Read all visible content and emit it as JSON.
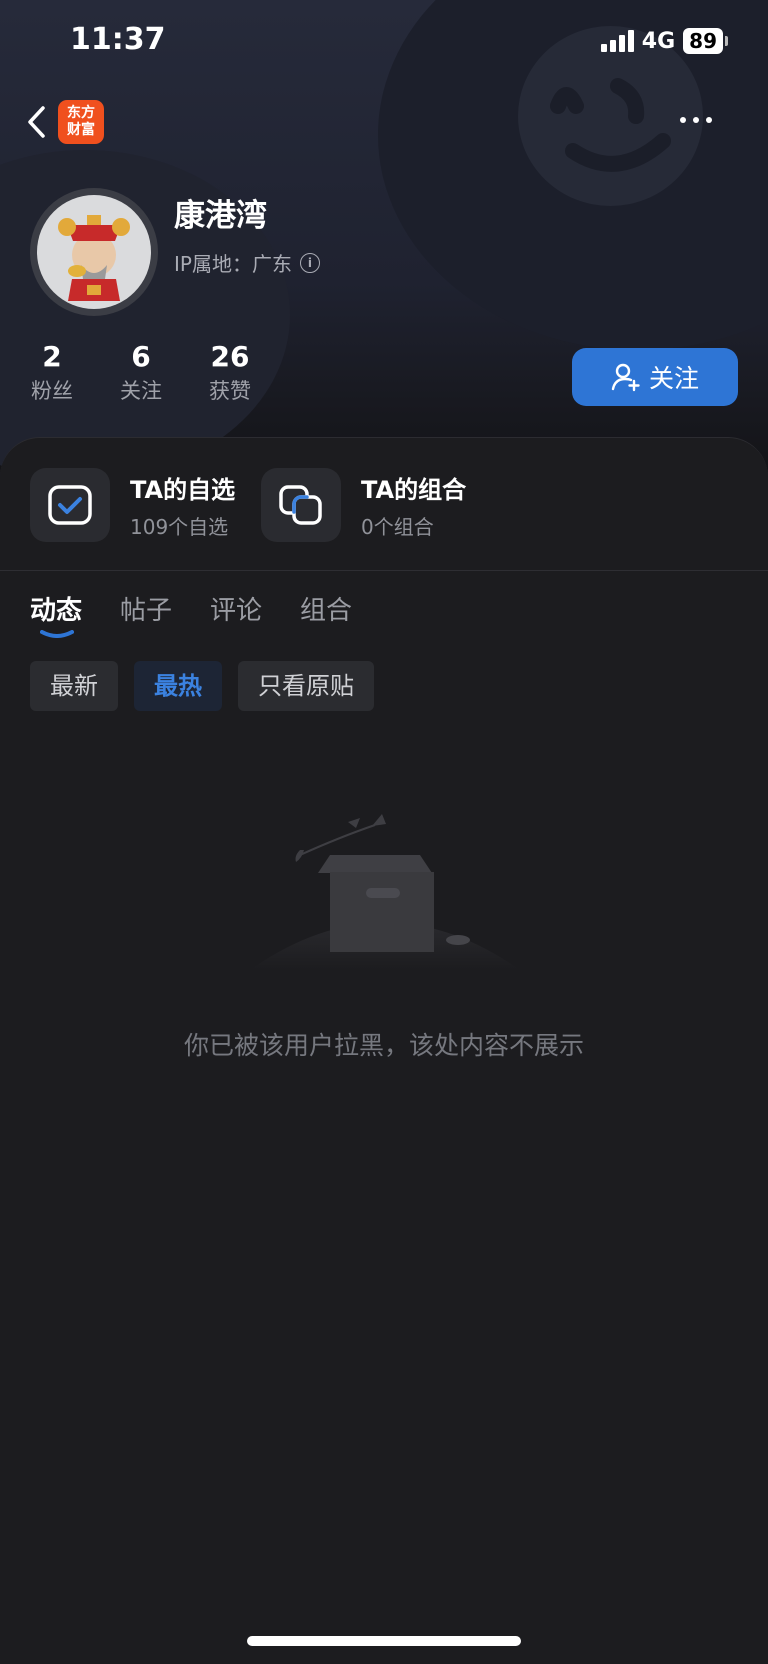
{
  "status_bar": {
    "time": "11:37",
    "network": "4G",
    "battery": "89"
  },
  "app_logo": {
    "line1": "东方",
    "line2": "财富"
  },
  "profile": {
    "name": "康港湾",
    "ip_location": "IP属地：广东",
    "stats": [
      {
        "value": "2",
        "label": "粉丝"
      },
      {
        "value": "6",
        "label": "关注"
      },
      {
        "value": "26",
        "label": "获赞"
      }
    ],
    "follow_label": "关注"
  },
  "quick_links": [
    {
      "title": "TA的自选",
      "subtitle": "109个自选",
      "icon": "watchlist-check-icon"
    },
    {
      "title": "TA的组合",
      "subtitle": "0个组合",
      "icon": "portfolio-icon"
    }
  ],
  "tabs": [
    {
      "label": "动态",
      "active": true
    },
    {
      "label": "帖子",
      "active": false
    },
    {
      "label": "评论",
      "active": false
    },
    {
      "label": "组合",
      "active": false
    }
  ],
  "filters": [
    {
      "label": "最新",
      "active": false
    },
    {
      "label": "最热",
      "active": true
    },
    {
      "label": "只看原贴",
      "active": false
    }
  ],
  "empty_message": "你已被该用户拉黑，该处内容不展示",
  "colors": {
    "accent": "#2e75d5",
    "background": "#19191b",
    "brand": "#f0501e"
  }
}
